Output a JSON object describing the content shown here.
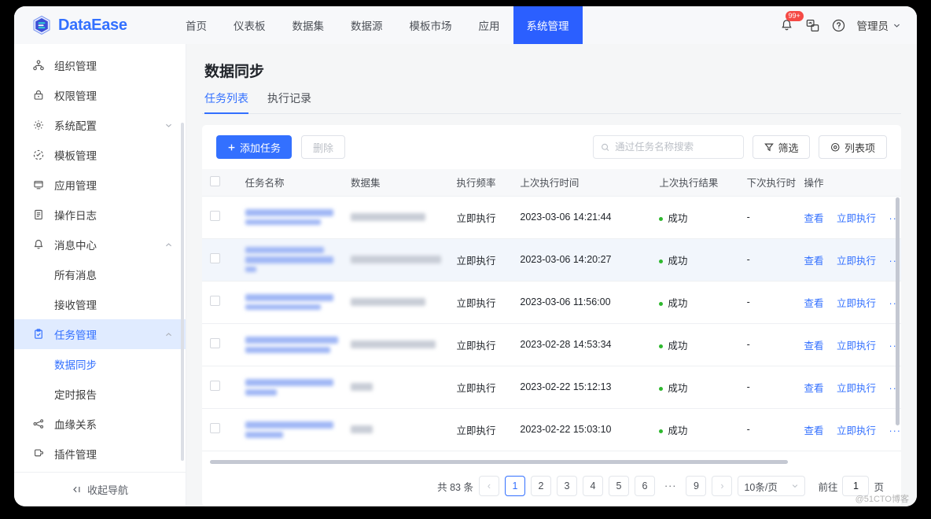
{
  "brand": {
    "name": "DataEase"
  },
  "topnav": {
    "items": [
      {
        "label": "首页",
        "active": false
      },
      {
        "label": "仪表板",
        "active": false
      },
      {
        "label": "数据集",
        "active": false
      },
      {
        "label": "数据源",
        "active": false
      },
      {
        "label": "模板市场",
        "active": false
      },
      {
        "label": "应用",
        "active": false
      },
      {
        "label": "系统管理",
        "active": true
      }
    ],
    "notification_badge": "99+",
    "user": "管理员"
  },
  "sidebar": {
    "items": [
      {
        "label": "组织管理",
        "icon": "org-icon",
        "expandable": false,
        "active": false
      },
      {
        "label": "权限管理",
        "icon": "lock-icon",
        "expandable": false,
        "active": false
      },
      {
        "label": "系统配置",
        "icon": "gear-icon",
        "expandable": true,
        "expanded": false,
        "active": false
      },
      {
        "label": "模板管理",
        "icon": "template-icon",
        "expandable": false,
        "active": false
      },
      {
        "label": "应用管理",
        "icon": "app-icon",
        "expandable": false,
        "active": false
      },
      {
        "label": "操作日志",
        "icon": "log-icon",
        "expandable": false,
        "active": false
      },
      {
        "label": "消息中心",
        "icon": "bell-icon",
        "expandable": true,
        "expanded": true,
        "active": false
      }
    ],
    "message_children": [
      {
        "label": "所有消息",
        "active": false
      },
      {
        "label": "接收管理",
        "active": false
      }
    ],
    "task_group": {
      "label": "任务管理",
      "icon": "clipboard-icon",
      "expandable": true,
      "expanded": true,
      "active": true
    },
    "task_children": [
      {
        "label": "数据同步",
        "active": true
      },
      {
        "label": "定时报告",
        "active": false
      }
    ],
    "tail_items": [
      {
        "label": "血缘关系",
        "icon": "lineage-icon",
        "expandable": false,
        "active": false
      },
      {
        "label": "插件管理",
        "icon": "plugin-icon",
        "expandable": false,
        "active": false
      }
    ],
    "collapse_label": "收起导航"
  },
  "page": {
    "title": "数据同步",
    "tabs": [
      {
        "label": "任务列表",
        "active": true
      },
      {
        "label": "执行记录",
        "active": false
      }
    ]
  },
  "toolbar": {
    "add_label": "添加任务",
    "delete_label": "删除",
    "search_placeholder": "通过任务名称搜索",
    "search_value": "",
    "filter_label": "筛选",
    "columns_label": "列表项"
  },
  "table": {
    "columns": [
      "任务名称",
      "数据集",
      "执行频率",
      "上次执行时间",
      "上次执行结果",
      "下次执行时间",
      "操作"
    ],
    "rows": [
      {
        "name": "",
        "dataset": "",
        "frequency": "立即执行",
        "last_time": "2023-03-06 14:21:44",
        "last_result": "成功",
        "next_time": "-",
        "hover": false,
        "name_lines": 2,
        "dataset_width": 95
      },
      {
        "name": "",
        "dataset": "",
        "frequency": "立即执行",
        "last_time": "2023-03-06 14:20:27",
        "last_result": "成功",
        "next_time": "-",
        "hover": true,
        "name_lines": 3,
        "dataset_width": 115
      },
      {
        "name": "",
        "dataset": "",
        "frequency": "立即执行",
        "last_time": "2023-03-06 11:56:00",
        "last_result": "成功",
        "next_time": "-",
        "hover": false,
        "name_lines": 2,
        "dataset_width": 95
      },
      {
        "name": "",
        "dataset": "",
        "frequency": "立即执行",
        "last_time": "2023-02-28 14:53:34",
        "last_result": "成功",
        "next_time": "-",
        "hover": false,
        "name_lines": 2,
        "dataset_width": 108
      },
      {
        "name": "",
        "dataset": "",
        "frequency": "立即执行",
        "last_time": "2023-02-22 15:12:13",
        "last_result": "成功",
        "next_time": "-",
        "hover": false,
        "name_lines": 2,
        "dataset_width": 28
      },
      {
        "name": "",
        "dataset": "",
        "frequency": "立即执行",
        "last_time": "2023-02-22 15:03:10",
        "last_result": "成功",
        "next_time": "-",
        "hover": false,
        "name_lines": 2,
        "dataset_width": 28
      }
    ],
    "actions": {
      "view": "查看",
      "run_now": "立即执行",
      "more": "···"
    }
  },
  "pagination": {
    "total_label": "共 83 条",
    "prev": "‹",
    "pages": [
      "1",
      "2",
      "3",
      "4",
      "5",
      "6"
    ],
    "ellipsis": "···",
    "last_page": "9",
    "next": "›",
    "current": "1",
    "page_size": "10条/页",
    "jump_prefix": "前往",
    "jump_value": "1",
    "jump_suffix": "页"
  },
  "watermark": "@51CTO博客",
  "colors": {
    "primary": "#3370ff",
    "nav_active": "#2b5fff",
    "success": "#2eb82e",
    "badge": "#f54a45"
  }
}
